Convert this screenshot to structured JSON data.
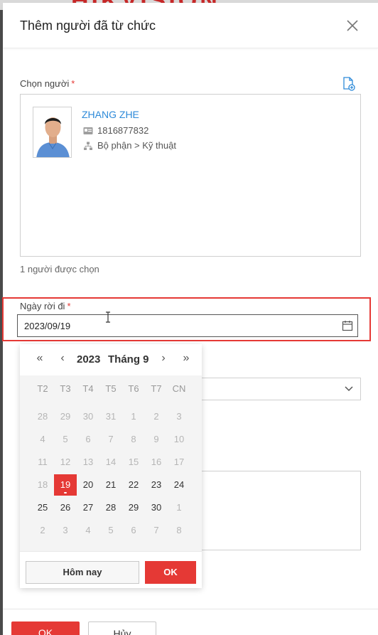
{
  "brand": {
    "text": "HIKVISION"
  },
  "dialog": {
    "title": "Thêm người đã từ chức",
    "select_person": {
      "label": "Chọn người",
      "required_mark": "*",
      "person": {
        "name": "ZHANG ZHE",
        "id": "1816877832",
        "department": "Bộ phận > Kỹ thuật"
      },
      "selected_count": "1 người được chọn"
    },
    "leave_date": {
      "label": "Ngày rời đi",
      "required_mark": "*",
      "value": "2023/09/19"
    }
  },
  "calendar": {
    "nav": {
      "prev_year": "«",
      "prev_month": "‹",
      "next_month": "›",
      "next_year": "»"
    },
    "year": "2023",
    "month": "Tháng 9",
    "weekdays": [
      "T2",
      "T3",
      "T4",
      "T5",
      "T6",
      "T7",
      "CN"
    ],
    "weeks": [
      [
        {
          "d": "28",
          "in": false
        },
        {
          "d": "29",
          "in": false
        },
        {
          "d": "30",
          "in": false
        },
        {
          "d": "31",
          "in": false
        },
        {
          "d": "1",
          "in": false
        },
        {
          "d": "2",
          "in": false
        },
        {
          "d": "3",
          "in": false
        }
      ],
      [
        {
          "d": "4",
          "in": false
        },
        {
          "d": "5",
          "in": false
        },
        {
          "d": "6",
          "in": false
        },
        {
          "d": "7",
          "in": false
        },
        {
          "d": "8",
          "in": false
        },
        {
          "d": "9",
          "in": false
        },
        {
          "d": "10",
          "in": false
        }
      ],
      [
        {
          "d": "11",
          "in": false
        },
        {
          "d": "12",
          "in": false
        },
        {
          "d": "13",
          "in": false
        },
        {
          "d": "14",
          "in": false
        },
        {
          "d": "15",
          "in": false
        },
        {
          "d": "16",
          "in": false
        },
        {
          "d": "17",
          "in": false
        }
      ],
      [
        {
          "d": "18",
          "in": false
        },
        {
          "d": "19",
          "in": true,
          "selected": true
        },
        {
          "d": "20",
          "in": true
        },
        {
          "d": "21",
          "in": true
        },
        {
          "d": "22",
          "in": true
        },
        {
          "d": "23",
          "in": true
        },
        {
          "d": "24",
          "in": true
        }
      ],
      [
        {
          "d": "25",
          "in": true
        },
        {
          "d": "26",
          "in": true
        },
        {
          "d": "27",
          "in": true
        },
        {
          "d": "28",
          "in": true
        },
        {
          "d": "29",
          "in": true
        },
        {
          "d": "30",
          "in": true
        },
        {
          "d": "1",
          "in": false
        }
      ],
      [
        {
          "d": "2",
          "in": false
        },
        {
          "d": "3",
          "in": false
        },
        {
          "d": "4",
          "in": false
        },
        {
          "d": "5",
          "in": false
        },
        {
          "d": "6",
          "in": false
        },
        {
          "d": "7",
          "in": false
        },
        {
          "d": "8",
          "in": false
        }
      ]
    ],
    "today_label": "Hôm nay",
    "ok_label": "OK"
  },
  "footer": {
    "ok_label": "OK",
    "cancel_label": "Hủy"
  },
  "colors": {
    "accent": "#e53935",
    "link": "#2d8ad9",
    "highlight_border": "#e53935"
  }
}
